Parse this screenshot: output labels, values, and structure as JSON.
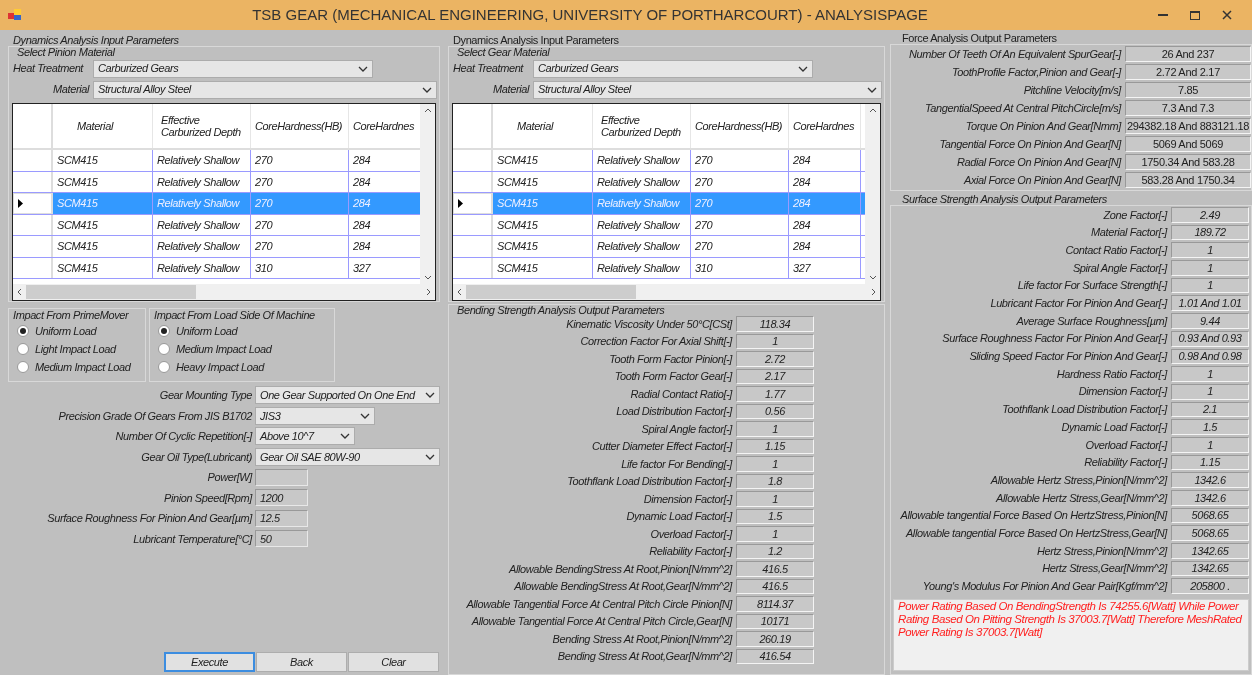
{
  "window": {
    "title": "TSB GEAR (MECHANICAL ENGINEERING, UNIVERSITY OF PORTHARCOURT) - ANALYSISPAGE"
  },
  "pinion_panel": {
    "title": "Dynamics Analysis Input Parameters",
    "group_title": "Select Pinion Material",
    "heat_treatment": {
      "label": "Heat Treatment",
      "value": "Carburized Gears"
    },
    "material": {
      "label": "Material",
      "value": "Structural Alloy Steel"
    },
    "grid": {
      "columns": [
        "Material",
        "Effective Carburized Depth",
        "CoreHardness(HB)",
        "CoreHardnes"
      ],
      "rows": [
        {
          "cells": [
            "SCM415",
            "Relatively Shallow",
            "270",
            "284"
          ],
          "selected": false
        },
        {
          "cells": [
            "SCM415",
            "Relatively Shallow",
            "270",
            "284"
          ],
          "selected": false
        },
        {
          "cells": [
            "SCM415",
            "Relatively Shallow",
            "270",
            "284"
          ],
          "selected": true
        },
        {
          "cells": [
            "SCM415",
            "Relatively Shallow",
            "270",
            "284"
          ],
          "selected": false
        },
        {
          "cells": [
            "SCM415",
            "Relatively Shallow",
            "270",
            "284"
          ],
          "selected": false
        },
        {
          "cells": [
            "SCM415",
            "Relatively Shallow",
            "310",
            "327"
          ],
          "selected": false
        }
      ]
    }
  },
  "gear_panel": {
    "title": "Dynamics Analysis Input Parameters",
    "group_title": "Select Gear Material",
    "heat_treatment": {
      "label": "Heat Treatment",
      "value": "Carburized Gears"
    },
    "material": {
      "label": "Material",
      "value": "Structural Alloy Steel"
    },
    "grid": {
      "columns": [
        "Material",
        "Effective Carburized Depth",
        "CoreHardness(HB)",
        "CoreHardnes"
      ],
      "rows": [
        {
          "cells": [
            "SCM415",
            "Relatively Shallow",
            "270",
            "284"
          ],
          "selected": false
        },
        {
          "cells": [
            "SCM415",
            "Relatively Shallow",
            "270",
            "284"
          ],
          "selected": false
        },
        {
          "cells": [
            "SCM415",
            "Relatively Shallow",
            "270",
            "284"
          ],
          "selected": true
        },
        {
          "cells": [
            "SCM415",
            "Relatively Shallow",
            "270",
            "284"
          ],
          "selected": false
        },
        {
          "cells": [
            "SCM415",
            "Relatively Shallow",
            "270",
            "284"
          ],
          "selected": false
        },
        {
          "cells": [
            "SCM415",
            "Relatively Shallow",
            "310",
            "327"
          ],
          "selected": false
        }
      ]
    }
  },
  "impact_prime_mover": {
    "title": "Impact From PrimeMover",
    "options": [
      {
        "label": "Uniform Load",
        "selected": true
      },
      {
        "label": "Light Impact Load",
        "selected": false
      },
      {
        "label": "Medium Impact Load",
        "selected": false
      }
    ]
  },
  "impact_load_side": {
    "title": "Impact From Load Side Of Machine",
    "options": [
      {
        "label": "Uniform Load",
        "selected": true
      },
      {
        "label": "Medium Impact Load",
        "selected": false
      },
      {
        "label": "Heavy Impact Load",
        "selected": false
      }
    ]
  },
  "settings": [
    {
      "kind": "combo",
      "label": "Gear Mounting Type",
      "value": "One Gear Supported On One End"
    },
    {
      "kind": "combo",
      "label": "Precision Grade Of Gears From JIS B1702",
      "value": "JIS3"
    },
    {
      "kind": "combo",
      "label": "Number Of Cyclic Repetition[-]",
      "value": "Above 10^7"
    },
    {
      "kind": "combo",
      "label": "Gear Oil Type(Lubricant)",
      "value": "Gear Oil SAE 80W-90"
    },
    {
      "kind": "text",
      "label": "Power[W]"
    },
    {
      "kind": "text",
      "label": "Pinion Speed[Rpm]",
      "value": "1200"
    },
    {
      "kind": "text",
      "label": "Surface Roughness For Pinion And Gear[µm]",
      "value": "12.5"
    },
    {
      "kind": "text",
      "label": "Lubricant Temperature[°C]",
      "value": "50"
    }
  ],
  "buttons": [
    {
      "label": "Execute",
      "focused": true
    },
    {
      "label": "Back",
      "focused": false
    },
    {
      "label": "Clear",
      "focused": false
    }
  ],
  "bending": {
    "title": "Bending Strength Analysis Output Parameters",
    "rows": [
      {
        "label": "Kinematic Viscosity Under 50°C[CSt]",
        "value": "118.34"
      },
      {
        "label": "Correction Factor For Axial Shift[-]",
        "value": "1"
      },
      {
        "label": "Tooth Form Factor Pinion[-]",
        "value": "2.72"
      },
      {
        "label": "Tooth Form Factor Gear[-]",
        "value": "2.17"
      },
      {
        "label": "Radial Contact Ratio[-]",
        "value": "1.77"
      },
      {
        "label": "Load Distribution Factor[-]",
        "value": "0.56"
      },
      {
        "label": "Spiral Angle factor[-]",
        "value": "1"
      },
      {
        "label": "Cutter Diameter Effect Factor[-]",
        "value": "1.15"
      },
      {
        "label": "Life factor For Bending[-]",
        "value": "1"
      },
      {
        "label": "Toothflank Load Distribution Factor[-]",
        "value": "1.8"
      },
      {
        "label": "Dimension Factor[-]",
        "value": "1"
      },
      {
        "label": "Dynamic Load Factor[-]",
        "value": "1.5"
      },
      {
        "label": "Overload Factor[-]",
        "value": "1"
      },
      {
        "label": "Reliability Factor[-]",
        "value": "1.2"
      },
      {
        "label": "Allowable BendingStress At Root,Pinion[N/mm^2]",
        "value": "416.5"
      },
      {
        "label": "Allowable BendingStress At Root,Gear[N/mm^2]",
        "value": "416.5"
      },
      {
        "label": "Allowable Tangential Force At Central Pitch Circle Pinion[N]",
        "value": "8114.37"
      },
      {
        "label": "Allowable Tangential Force At Central Pitch Circle,Gear[N]",
        "value": "10171"
      },
      {
        "label": "Bending Stress At Root,Pinion[N/mm^2]",
        "value": "260.19"
      },
      {
        "label": "Bending Stress At Root,Gear[N/mm^2]",
        "value": "416.54"
      }
    ]
  },
  "force": {
    "title": "Force Analysis Output Parameters",
    "rows": [
      {
        "label": "Number Of Teeth Of An Equivalent SpurGear[-]",
        "value": "26 And 237"
      },
      {
        "label": "ToothProfile Factor,Pinion and Gear[-]",
        "value": "2.72 And 2.17"
      },
      {
        "label": "Pitchline Velocity[m/s]",
        "value": "7.85"
      },
      {
        "label": "TangentialSpeed At Central PitchCircle[m/s]",
        "value": "7.3 And 7.3"
      },
      {
        "label": "Torque On Pinion And Gear[Nmm]",
        "value": "294382.18 And 883121.18"
      },
      {
        "label": "Tangential Force On Pinion And Gear[N]",
        "value": "5069 And 5069"
      },
      {
        "label": "Radial Force On Pinion And Gear[N]",
        "value": "1750.34 And 583.28"
      },
      {
        "label": "Axial Force On Pinion And Gear[N]",
        "value": "583.28 And 1750.34"
      }
    ]
  },
  "surface": {
    "title": "Surface Strength Analysis Output Parameters",
    "rows": [
      {
        "label": "Zone Factor[-]",
        "value": "2.49"
      },
      {
        "label": "Material Factor[-]",
        "value": "189.72"
      },
      {
        "label": "Contact Ratio Factor[-]",
        "value": "1"
      },
      {
        "label": "Spiral Angle Factor[-]",
        "value": "1"
      },
      {
        "label": "Life factor For Surface Strength[-]",
        "value": "1"
      },
      {
        "label": "Lubricant Factor For Pinion And Gear[-]",
        "value": "1.01 And 1.01"
      },
      {
        "label": "Average Surface Roughness[µm]",
        "value": "9.44"
      },
      {
        "label": "Surface Roughness Factor For Pinion And Gear[-]",
        "value": "0.93 And 0.93"
      },
      {
        "label": "Sliding Speed Factor For Pinion And Gear[-]",
        "value": "0.98 And 0.98"
      },
      {
        "label": "Hardness Ratio Factor[-]",
        "value": "1"
      },
      {
        "label": "Dimension Factor[-]",
        "value": "1"
      },
      {
        "label": "Toothflank Load Distribution Factor[-]",
        "value": "2.1"
      },
      {
        "label": "Dynamic Load Factor[-]",
        "value": "1.5"
      },
      {
        "label": "Overload Factor[-]",
        "value": "1"
      },
      {
        "label": "Reliability Factor[-]",
        "value": "1.15"
      },
      {
        "label": "Allowable Hertz Stress,Pinion[N/mm^2]",
        "value": "1342.6"
      },
      {
        "label": "Allowable Hertz Stress,Gear[N/mm^2]",
        "value": "1342.6"
      },
      {
        "label": "Allowable tangential Force Based On HertzStress,Pinion[N]",
        "value": "5068.65"
      },
      {
        "label": "Allowable tangential Force Based On HertzStress,Gear[N]",
        "value": "5068.65"
      },
      {
        "label": "Hertz Stress,Pinion[N/mm^2]",
        "value": "1342.65"
      },
      {
        "label": "Hertz Stress,Gear[N/mm^2]",
        "value": "1342.65"
      },
      {
        "label": "Young's Modulus For Pinion And Gear Pair[Kgf/mm^2]",
        "value": "205800 ."
      }
    ]
  },
  "message": "Power Rating Based On BendingStrength Is 74255.6[Watt] While Power Rating Based On Pitting Strength Is 37003.7[Watt]  Therefore MeshRated Power Rating Is 37003.7[Watt]"
}
